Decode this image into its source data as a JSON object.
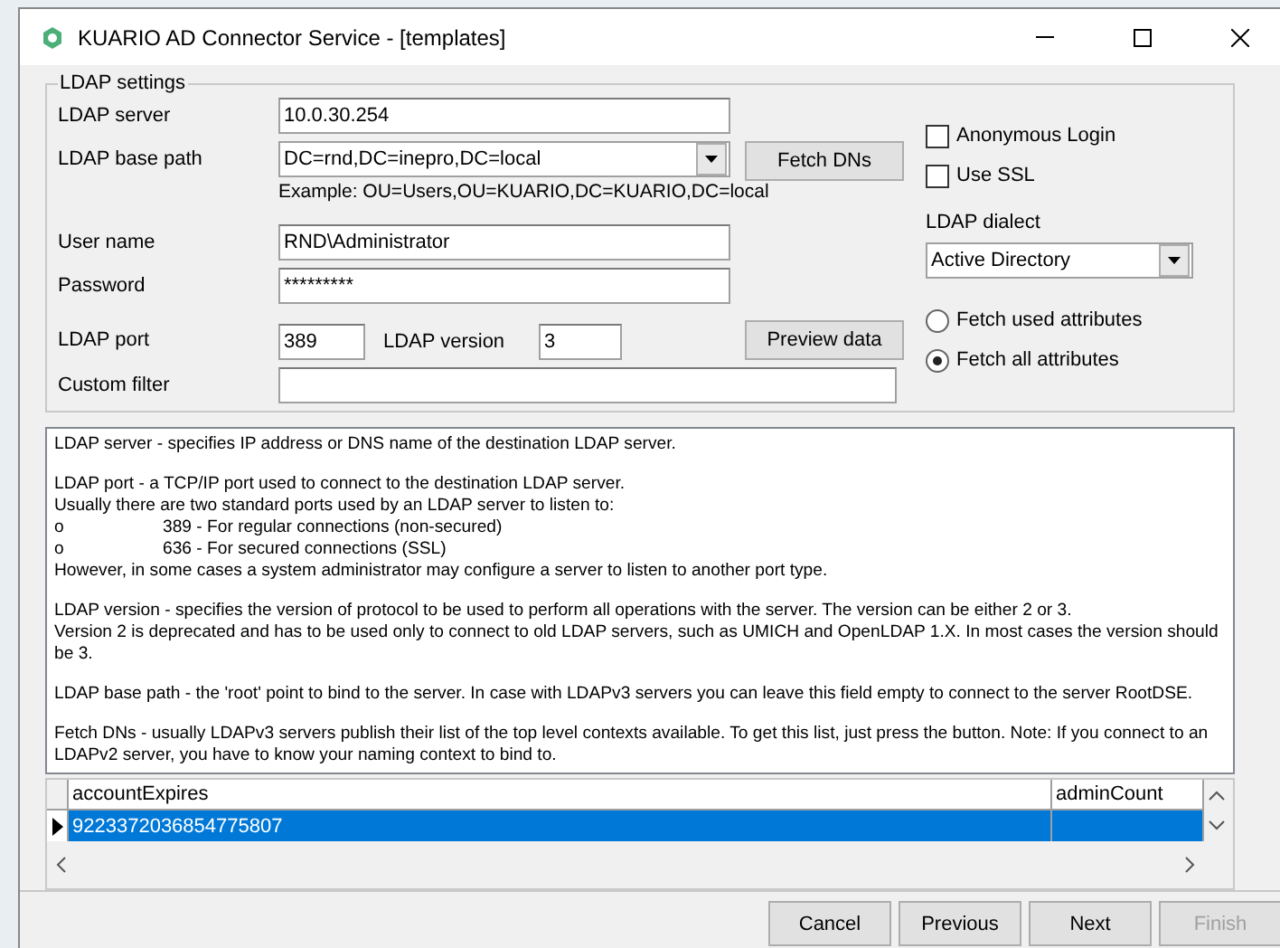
{
  "window": {
    "title": "KUARIO AD Connector Service - [templates]"
  },
  "ldap_settings": {
    "legend": "LDAP settings",
    "server": {
      "label": "LDAP server",
      "value": "10.0.30.254"
    },
    "base_path": {
      "label": "LDAP base path",
      "value": "DC=rnd,DC=inepro,DC=local",
      "example": "Example: OU=Users,OU=KUARIO,DC=KUARIO,DC=local"
    },
    "fetch_dns": "Fetch DNs",
    "user_name": {
      "label": "User name",
      "value": "RND\\Administrator"
    },
    "password": {
      "label": "Password",
      "value": "*********"
    },
    "port": {
      "label": "LDAP port",
      "value": "389"
    },
    "version": {
      "label": "LDAP version",
      "value": "3"
    },
    "preview_data": "Preview data",
    "custom_filter": {
      "label": "Custom filter"
    },
    "checkboxes": [
      {
        "label": "Anonymous Login",
        "checked": false
      },
      {
        "label": "Use SSL",
        "checked": false
      }
    ],
    "dialect": {
      "label": "LDAP dialect",
      "value": "Active Directory"
    },
    "radios": [
      {
        "label": "Fetch used attributes",
        "selected": false
      },
      {
        "label": "Fetch all attributes",
        "selected": true
      }
    ]
  },
  "help_text": [
    "LDAP server - specifies IP address or DNS name of the destination LDAP server.",
    "LDAP port - a TCP/IP port used to connect to the destination LDAP server.\nUsually there are two standard ports used by an LDAP server to listen to:\no\t389 - For regular connections (non-secured)\no\t636 - For secured connections (SSL)\nHowever, in some cases a system administrator may configure a server to listen to another port type.",
    "LDAP version - specifies the version of protocol to be used to perform all operations with the server. The version can be either 2 or 3.\nVersion 2 is deprecated and has to be used only to connect to old LDAP servers, such as UMICH and OpenLDAP 1.X. In most cases the version should be 3.",
    "LDAP base path - the 'root' point to bind to the server. In case with LDAPv3 servers you can leave this field empty to connect to the server RootDSE.",
    "Fetch DNs - usually LDAPv3 servers publish their list of the top level contexts available. To get this list, just press the button. Note: If you connect to an LDAPv2 server, you have to know your naming context to bind to."
  ],
  "grid": {
    "columns": [
      "accountExpires",
      "adminCount"
    ],
    "rows": [
      {
        "cells": [
          "9223372036854775807",
          null
        ],
        "selected": true
      }
    ]
  },
  "buttons": [
    {
      "label": "Cancel",
      "disabled": false
    },
    {
      "label": "Previous",
      "disabled": false
    },
    {
      "label": "Next",
      "disabled": false
    },
    {
      "label": "Finish",
      "disabled": true
    }
  ]
}
